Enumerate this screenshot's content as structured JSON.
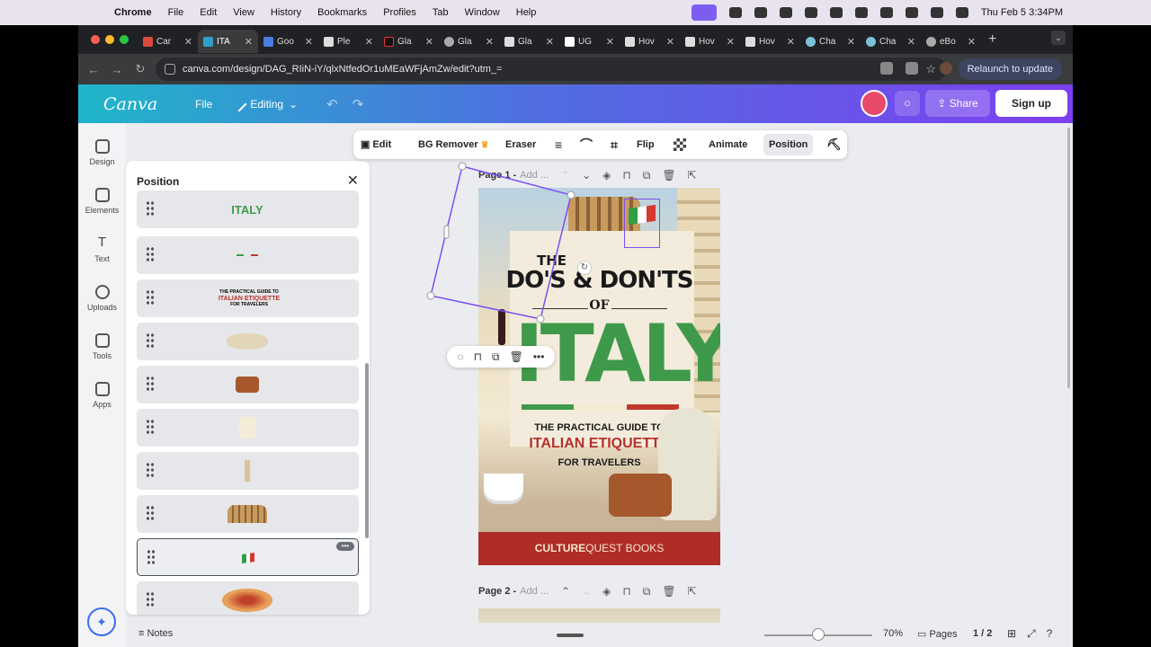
{
  "menubar": {
    "app": "Chrome",
    "items": [
      "File",
      "Edit",
      "View",
      "History",
      "Bookmarks",
      "Profiles",
      "Tab",
      "Window",
      "Help"
    ],
    "datetime": "Thu Feb 5  3:34PM"
  },
  "browser": {
    "tabs": [
      "Car",
      "ITA",
      "Goo",
      "Ple",
      "Gla",
      "Gla",
      "Gla",
      "UG",
      "Hov",
      "Hov",
      "Hov",
      "Cha",
      "Cha",
      "eBo"
    ],
    "url": "canva.com/design/DAG_RIiN-iY/qlxNtfedOr1uMEaWFjAmZw/edit?utm_=",
    "relaunch": "Relaunch to update"
  },
  "canva_header": {
    "logo": "Canva",
    "file": "File",
    "editing": "Editing",
    "share": "Share",
    "signup": "Sign up"
  },
  "rail": [
    "Design",
    "Elements",
    "Text",
    "Uploads",
    "Tools",
    "Apps"
  ],
  "panel": {
    "title": "Position",
    "layers": [
      {
        "thumb_text": "ITALY",
        "kind": "text"
      },
      {
        "thumb_text": "— —",
        "kind": "lines"
      },
      {
        "thumb_line1": "THE PRACTICAL GUIDE TO",
        "thumb_line2": "ITALIAN ETIQUETTE",
        "thumb_line3": "FOR TRAVELERS",
        "kind": "subtitle"
      },
      {
        "kind": "table"
      },
      {
        "kind": "bag"
      },
      {
        "kind": "paper"
      },
      {
        "kind": "tower"
      },
      {
        "kind": "colosseum"
      },
      {
        "kind": "flag",
        "selected": true
      },
      {
        "kind": "pizza"
      }
    ]
  },
  "toolbar": {
    "edit": "Edit",
    "bg_remover": "BG Remover",
    "eraser": "Eraser",
    "flip": "Flip",
    "animate": "Animate",
    "position": "Position"
  },
  "page1": {
    "label": "Page 1 -",
    "add": "Add ..."
  },
  "page2": {
    "label": "Page 2 -",
    "add": "Add ..."
  },
  "cover": {
    "the": "THE",
    "dos": "DO'S & DON'TS",
    "of": "OF",
    "italy": "ITALY",
    "practical": "THE PRACTICAL GUIDE TO",
    "etiquette": "ITALIAN ETIQUETTE",
    "travelers": "FOR TRAVELERS",
    "banner_bold": "CULTURE",
    "banner_rest": "QUEST BOOKS"
  },
  "bottom": {
    "notes": "Notes",
    "zoom": "70%",
    "pages": "Pages",
    "page_count": "1 / 2"
  },
  "colors": {
    "italy_green": "#3e9a4a",
    "etiquette_red": "#b5302a",
    "banner_red": "#b02c26",
    "selection_purple": "#7d4ff0"
  }
}
